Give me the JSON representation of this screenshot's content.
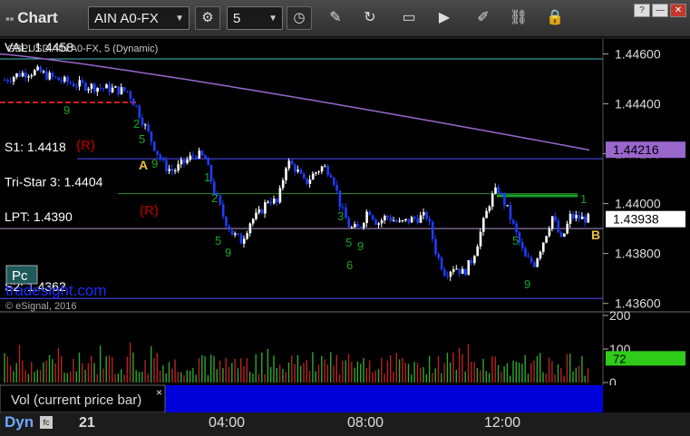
{
  "toolbar": {
    "title": "Chart",
    "symbol": "AIN A0-FX",
    "interval": "5",
    "window_buttons": [
      "?",
      "—",
      "✕"
    ]
  },
  "chart": {
    "series_label": "GBPUSD AIN A0-FX, 5 (Dynamic)",
    "watermark": "tradesight.com",
    "copyright": "© eSignal, 2016",
    "pc_label": "Pc",
    "vol_panel_label": "Vol (current price bar)",
    "vol_close_symbol": "×"
  },
  "statusbar": {
    "dyn_label": "Dyn",
    "day": "21",
    "times": [
      "04:00",
      "08:00",
      "12:00"
    ]
  },
  "colors": {
    "background": "#000000",
    "up_candle": "#ffffff",
    "down_candle": "#1e3cff",
    "ma_line": "#9966cc",
    "level_line": "#5050ff",
    "green_marker": "#1aa32a",
    "volume_axis_badge": "#2ecc18",
    "price_badge_ma": "#9966cc"
  },
  "chart_data": {
    "type": "candlestick",
    "title": "GBPUSD AIN A0-FX, 5 (Dynamic)",
    "price_axis": {
      "ticks": [
        "1.44600",
        "1.44400",
        "1.44200",
        "1.44000",
        "1.43800",
        "1.43600"
      ],
      "range": [
        1.4357,
        1.4466
      ]
    },
    "price_badges": [
      {
        "label": "1.44216",
        "value": 1.44216,
        "color": "#9966cc",
        "text_color": "#000000"
      },
      {
        "label": "1.43938",
        "value": 1.43938,
        "color": "#ffffff",
        "text_color": "#000000"
      }
    ],
    "levels": [
      {
        "label": "VAL: 1.4458",
        "value": 1.4458,
        "color": "#40c0c0",
        "style": "solid"
      },
      {
        "label": "S1: 1.4418",
        "value": 1.4418,
        "color": "#5050ff",
        "style": "solid"
      },
      {
        "label": "Tri-Star 3: 1.4404",
        "value": 1.4404,
        "color": "#2e8b2e",
        "style": "solid"
      },
      {
        "label": "LPT: 1.4390",
        "value": 1.439,
        "color": "#b090d0",
        "style": "solid"
      },
      {
        "label": "S2: 1.4362",
        "value": 1.4362,
        "color": "#5050ff",
        "style": "solid"
      }
    ],
    "annotations": [
      {
        "text": "(R)",
        "color": "#8b0000"
      },
      {
        "text": "(R)",
        "color": "#8b0000"
      },
      {
        "text": "A",
        "color": "#f0c040"
      },
      {
        "text": "B",
        "color": "#f0c040"
      }
    ],
    "volume_axis": {
      "ticks": [
        "200",
        "100",
        "0"
      ],
      "range": [
        0,
        200
      ]
    },
    "volume_badge": {
      "label": "72",
      "value": 72
    }
  }
}
